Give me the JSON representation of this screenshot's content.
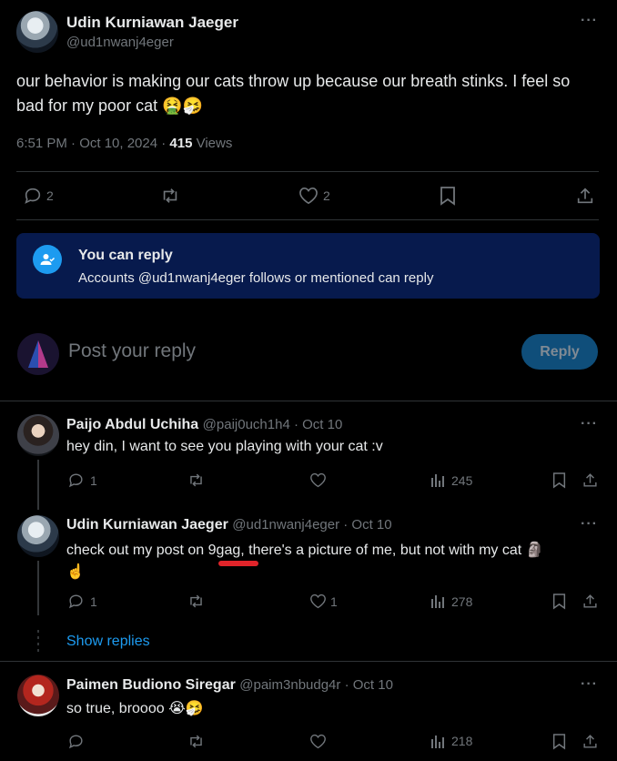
{
  "main_post": {
    "display_name": "Udin Kurniawan Jaeger",
    "handle": "@ud1nwanj4eger",
    "text": "our behavior is making our cats throw up because our breath stinks. I feel so bad for my poor cat 🤮🤧",
    "time": "6:51 PM · Oct 10, 2024 · ",
    "views_count": "415",
    "views_label": " Views",
    "replies": "2",
    "likes": "2"
  },
  "reply_notice": {
    "title": "You can reply",
    "subtitle": "Accounts @ud1nwanj4eger follows or mentioned can reply"
  },
  "composer": {
    "placeholder": "Post your reply",
    "button": "Reply"
  },
  "replies": [
    {
      "display_name": "Paijo Abdul Uchiha",
      "handle_date": "@paij0uch1h4 · Oct 10",
      "text": "hey din, I want to see you playing with your cat :v",
      "replies": "1",
      "likes": "",
      "views": "245"
    },
    {
      "display_name": "Udin Kurniawan Jaeger",
      "handle_date": "@ud1nwanj4eger · Oct 10",
      "text_before": "check out my post on ",
      "text_link": "9gag",
      "text_after": ", there's a picture of me, but not with my cat 🗿",
      "text_line2": "☝️",
      "replies": "1",
      "likes": "1",
      "views": "278"
    },
    {
      "display_name": "Paimen Budiono Siregar",
      "handle_date": "@paim3nbudg4r · Oct 10",
      "text": "so true, broooo 😭🤧",
      "replies": "",
      "likes": "",
      "views": "218"
    }
  ],
  "show_replies": "Show replies",
  "colors": {
    "accent": "#1d9bf0",
    "notice_bg": "#071a4d",
    "reply_btn": "#0f4e7a",
    "underline": "#e0242a"
  }
}
